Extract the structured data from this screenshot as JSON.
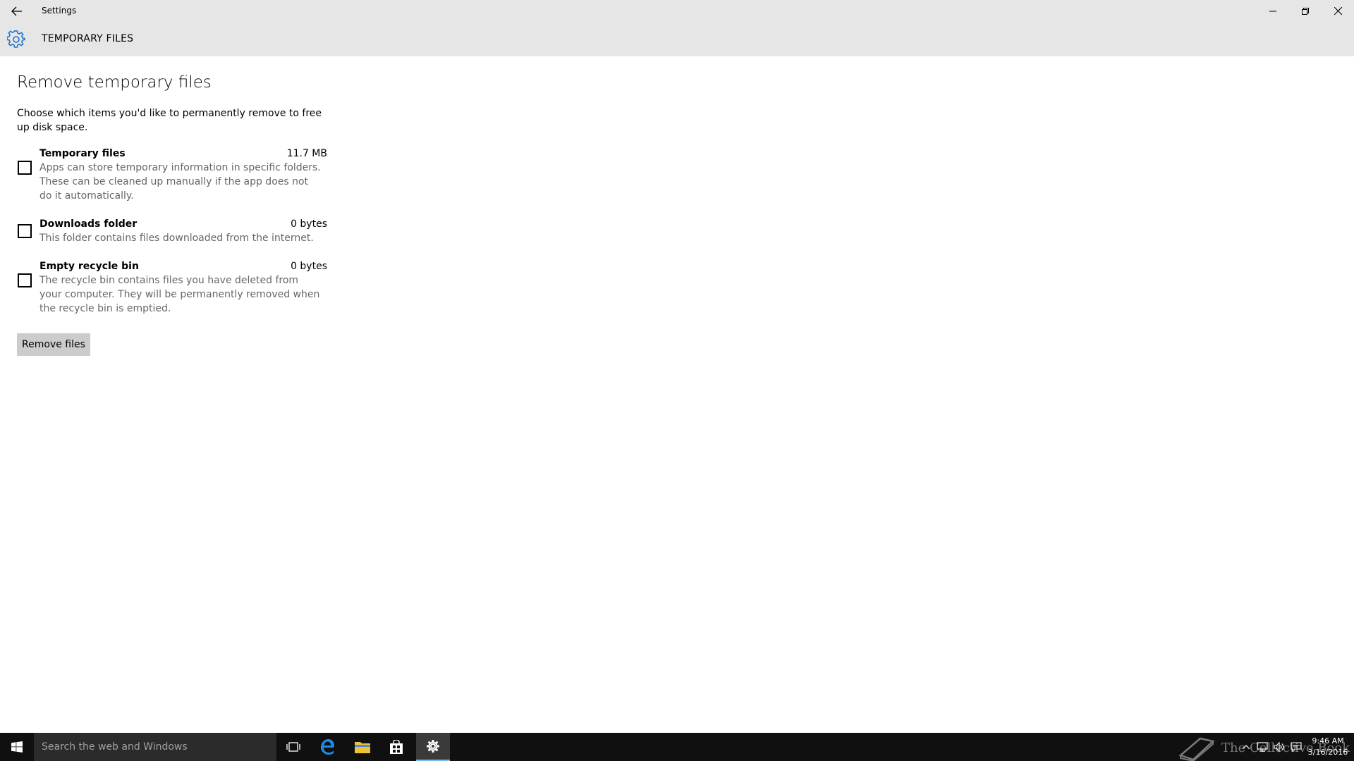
{
  "window": {
    "title": "Settings",
    "header_title": "TEMPORARY FILES",
    "accent_color": "#1e73c8"
  },
  "page": {
    "title": "Remove temporary files",
    "intro": "Choose which items you'd like to permanently remove to free up disk space."
  },
  "items": [
    {
      "title": "Temporary files",
      "size": "11.7 MB",
      "description": "Apps can store temporary information in specific folders. These can be cleaned up manually if the app does not do it automatically.",
      "checked": false
    },
    {
      "title": "Downloads folder",
      "size": "0 bytes",
      "description": "This folder contains files downloaded from the internet.",
      "checked": false
    },
    {
      "title": "Empty recycle bin",
      "size": "0 bytes",
      "description": "The recycle bin contains files you have deleted from your computer. They will be permanently removed when the recycle bin is emptied.",
      "checked": false
    }
  ],
  "actions": {
    "remove_label": "Remove files"
  },
  "taskbar": {
    "search_placeholder": "Search the web and Windows",
    "apps": [
      "task-view-icon",
      "edge-icon",
      "file-explorer-icon",
      "store-icon",
      "settings-icon"
    ],
    "active_app": "settings-icon",
    "clock_time": "9:46 AM",
    "clock_date": "3/16/2016",
    "watermark": "The Collective Book"
  }
}
